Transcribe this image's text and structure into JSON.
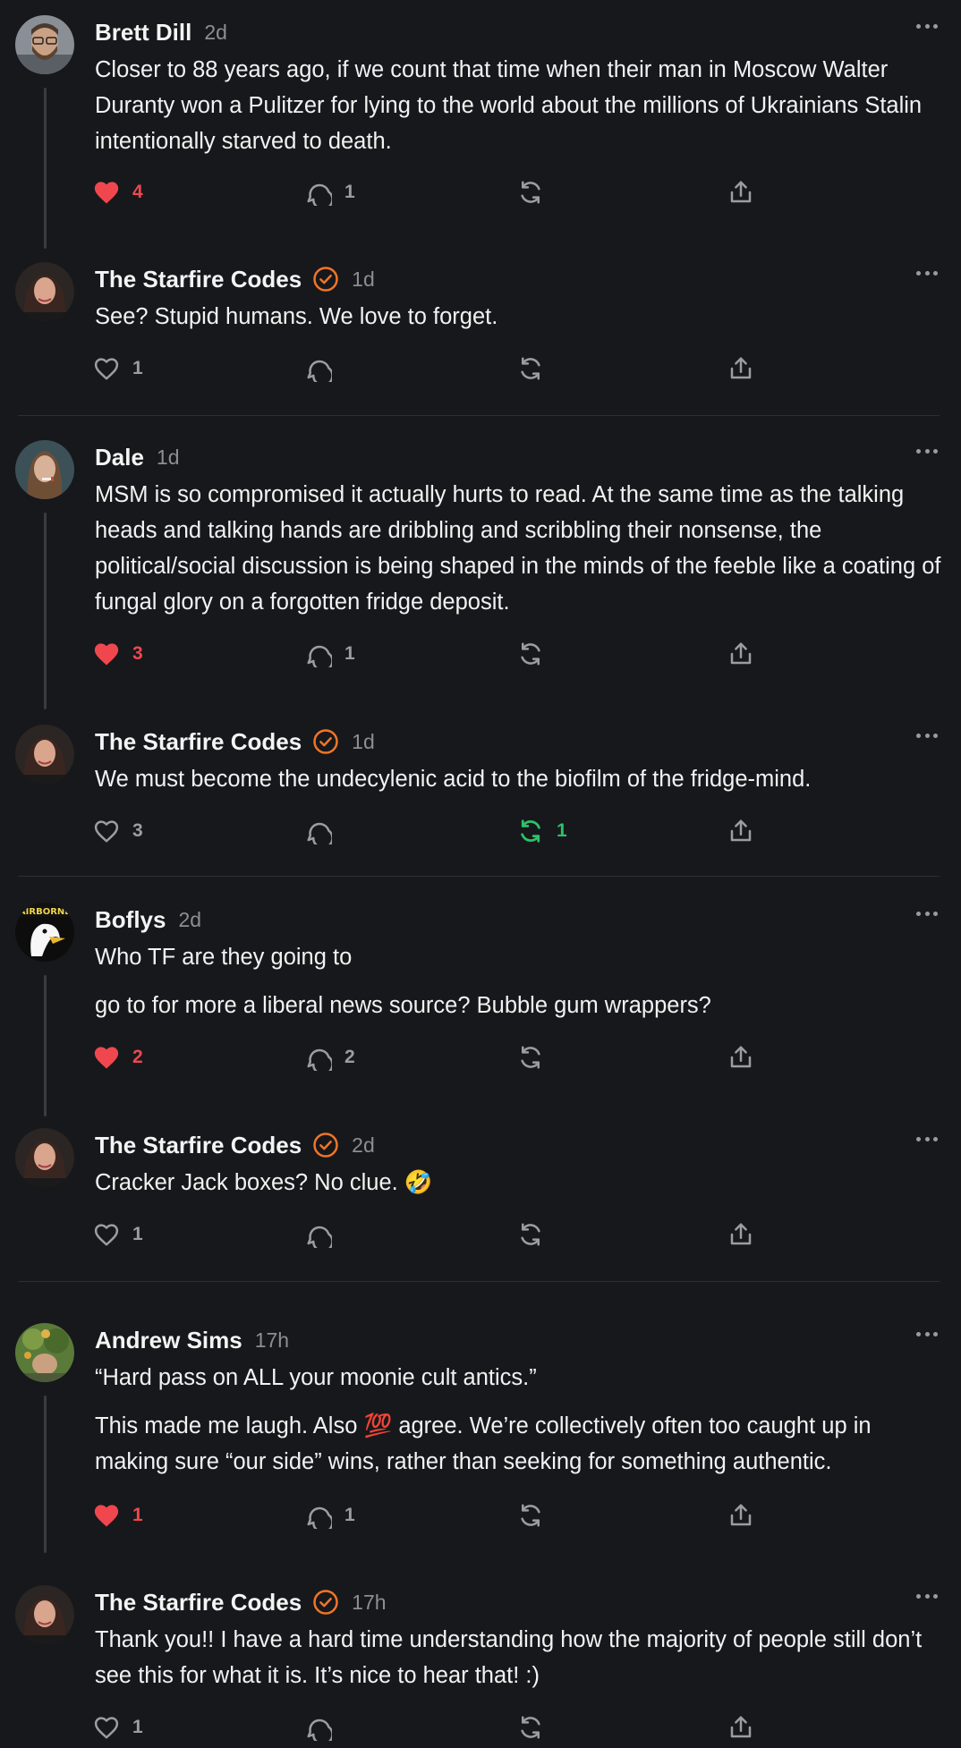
{
  "colors": {
    "background": "#17181b",
    "like_active": "#f0474f",
    "restack_active": "#2cc26a",
    "verified_badge": "#f07528",
    "muted": "#9c9da2"
  },
  "icons": {
    "like": "heart-icon",
    "reply": "speech-bubble-icon",
    "restack": "restack-arrows-icon",
    "share": "share-icon",
    "more": "more-dots-icon",
    "verified": "verified-check-icon"
  },
  "comments": [
    {
      "author": "Brett Dill",
      "time": "2d",
      "verified": false,
      "paragraphs": [
        "Closer to 88 years ago, if we count that time when their man in Moscow Walter Duranty won a Pulitzer for lying to the world about the millions of Ukrainians Stalin intentionally starved to death."
      ],
      "likes": "4",
      "liked": true,
      "replies": "1",
      "restacks": "",
      "restacked": false
    },
    {
      "author": "The Starfire Codes",
      "time": "1d",
      "verified": true,
      "paragraphs": [
        "See? Stupid humans. We love to forget."
      ],
      "likes": "1",
      "liked": false,
      "replies": "",
      "restacks": "",
      "restacked": false
    },
    {
      "author": "Dale",
      "time": "1d",
      "verified": false,
      "paragraphs": [
        "MSM is so compromised it actually hurts to read. At the same time as the talking heads and talking hands are dribbling and scribbling their nonsense, the political/social discussion is being shaped in the minds of the feeble like a coating of fungal glory on a forgotten fridge deposit."
      ],
      "likes": "3",
      "liked": true,
      "replies": "1",
      "restacks": "",
      "restacked": false
    },
    {
      "author": "The Starfire Codes",
      "time": "1d",
      "verified": true,
      "paragraphs": [
        "We must become the undecylenic acid to the biofilm of the fridge-mind."
      ],
      "likes": "3",
      "liked": false,
      "replies": "",
      "restacks": "1",
      "restacked": true
    },
    {
      "author": "Boflys",
      "time": "2d",
      "verified": false,
      "avatar_text": "AIRBORNE",
      "paragraphs": [
        "Who TF are they going to",
        "go to for more a liberal news source? Bubble gum wrappers?"
      ],
      "likes": "2",
      "liked": true,
      "replies": "2",
      "restacks": "",
      "restacked": false
    },
    {
      "author": "The Starfire Codes",
      "time": "2d",
      "verified": true,
      "paragraphs": [
        "Cracker Jack boxes? No clue. 🤣"
      ],
      "likes": "1",
      "liked": false,
      "replies": "",
      "restacks": "",
      "restacked": false
    },
    {
      "author": "Andrew Sims",
      "time": "17h",
      "verified": false,
      "paragraphs": [
        "“Hard pass on ALL your moonie cult antics.”",
        "This made me laugh. Also 💯 agree. We’re collectively often too caught up in making sure “our side” wins, rather than seeking for something authentic."
      ],
      "likes": "1",
      "liked": true,
      "replies": "1",
      "restacks": "",
      "restacked": false
    },
    {
      "author": "The Starfire Codes",
      "time": "17h",
      "verified": true,
      "paragraphs": [
        "Thank you!! I have a hard time understanding how the majority of people still don’t see this for what it is. It’s nice to hear that! :)"
      ],
      "likes": "1",
      "liked": false,
      "replies": "",
      "restacks": "",
      "restacked": false
    }
  ]
}
